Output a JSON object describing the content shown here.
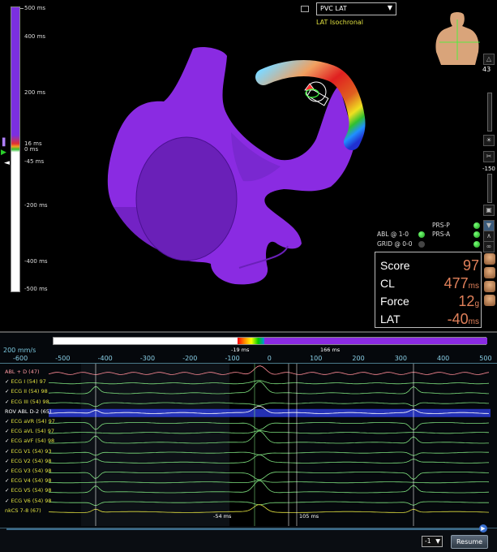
{
  "lat_scale": {
    "labels": [
      "500 ms",
      "400 ms",
      "200 ms",
      "16 ms",
      "0 ms",
      "-45 ms",
      "-200 ms",
      "-400 ms",
      "-500 ms"
    ]
  },
  "map": {
    "selected_map": "PVC LAT",
    "subtitle": "LAT Isochronal",
    "zoom_value": "43",
    "slider_value": "-150"
  },
  "status": {
    "abl": "ABL @ 1-0",
    "grid": "GRID @ 0-0",
    "prs_p": "PRS-P",
    "prs_a": "PRS-A"
  },
  "stats": {
    "score_label": "Score",
    "score_value": "97",
    "score_unit": "",
    "cl_label": "CL",
    "cl_value": "477",
    "cl_unit": "ms",
    "force_label": "Force",
    "force_value": "12",
    "force_unit": "g",
    "lat_label": "LAT",
    "lat_value": "-40",
    "lat_unit": "ms"
  },
  "egm": {
    "speed": "200 mm/s",
    "time_ticks": [
      "-600",
      "-500",
      "-400",
      "-300",
      "-200",
      "-100",
      "0",
      "100",
      "200",
      "300",
      "400",
      "500"
    ],
    "window_left": "-19 ms",
    "window_right": "166 ms",
    "channels": [
      {
        "label": "ABL + D (47)",
        "checked": false,
        "color": "pink"
      },
      {
        "label": "ECG I (54)  97",
        "checked": true,
        "color": "yellow"
      },
      {
        "label": "ECG II (54)  98",
        "checked": true,
        "color": "yellow"
      },
      {
        "label": "ECG III (54)  98",
        "checked": true,
        "color": "yellow"
      },
      {
        "label": "ROV ABL   D-2 (65)",
        "checked": false,
        "color": "white"
      },
      {
        "label": "ECG aVR (54)  97",
        "checked": true,
        "color": "yellow"
      },
      {
        "label": "ECG aVL (54)  97",
        "checked": true,
        "color": "yellow"
      },
      {
        "label": "ECG aVF (54)  98",
        "checked": true,
        "color": "yellow"
      },
      {
        "label": "ECG V1 (54)  93",
        "checked": true,
        "color": "yellow"
      },
      {
        "label": "ECG V2 (54)  98",
        "checked": true,
        "color": "yellow"
      },
      {
        "label": "ECG V3 (54)  98",
        "checked": true,
        "color": "yellow"
      },
      {
        "label": "ECG V4 (54)  98",
        "checked": true,
        "color": "yellow"
      },
      {
        "label": "ECG V5 (54)  98",
        "checked": true,
        "color": "yellow"
      },
      {
        "label": "ECG V6 (54)  98",
        "checked": true,
        "color": "yellow"
      },
      {
        "label": "nkCS  7-8 (67)",
        "checked": false,
        "color": "yellow"
      }
    ],
    "measure_left": "-54 ms",
    "measure_right": "105 ms",
    "zoom_option": "-1",
    "resume_label": "Resume"
  },
  "colors": {
    "map_purple": "#8a2be2",
    "trace_green": "#7ee07e",
    "trace_blue": "#3344ff",
    "trace_pink": "#ff8a95",
    "accent_orange": "#e0805a"
  }
}
